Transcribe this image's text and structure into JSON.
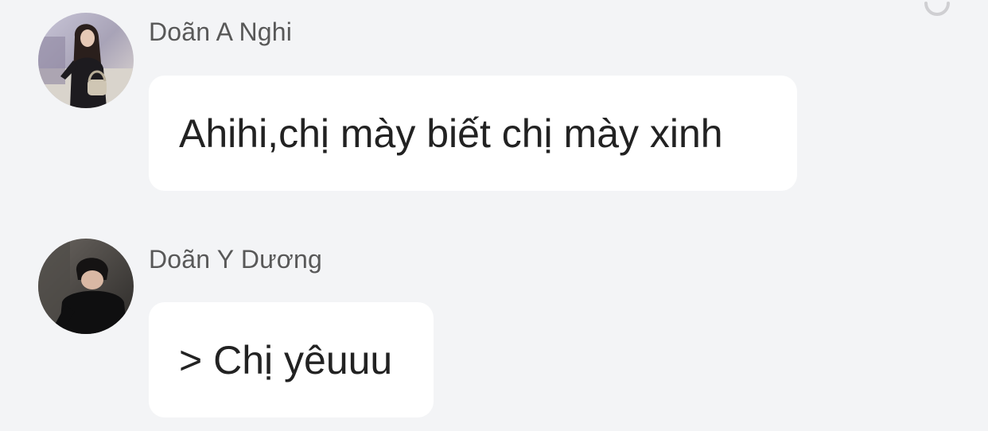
{
  "messages": [
    {
      "sender": "Doãn A Nghi",
      "text": "Ahihi,chị mày biết chị mày xinh",
      "avatar_icon": "user-avatar-girl"
    },
    {
      "sender": "Doãn Y Dương",
      "text": "> Chị yêuuu",
      "avatar_icon": "user-avatar-boy"
    }
  ],
  "colors": {
    "background": "#f3f4f6",
    "bubble": "#ffffff",
    "sender_text": "#585858",
    "message_text": "#222222"
  }
}
